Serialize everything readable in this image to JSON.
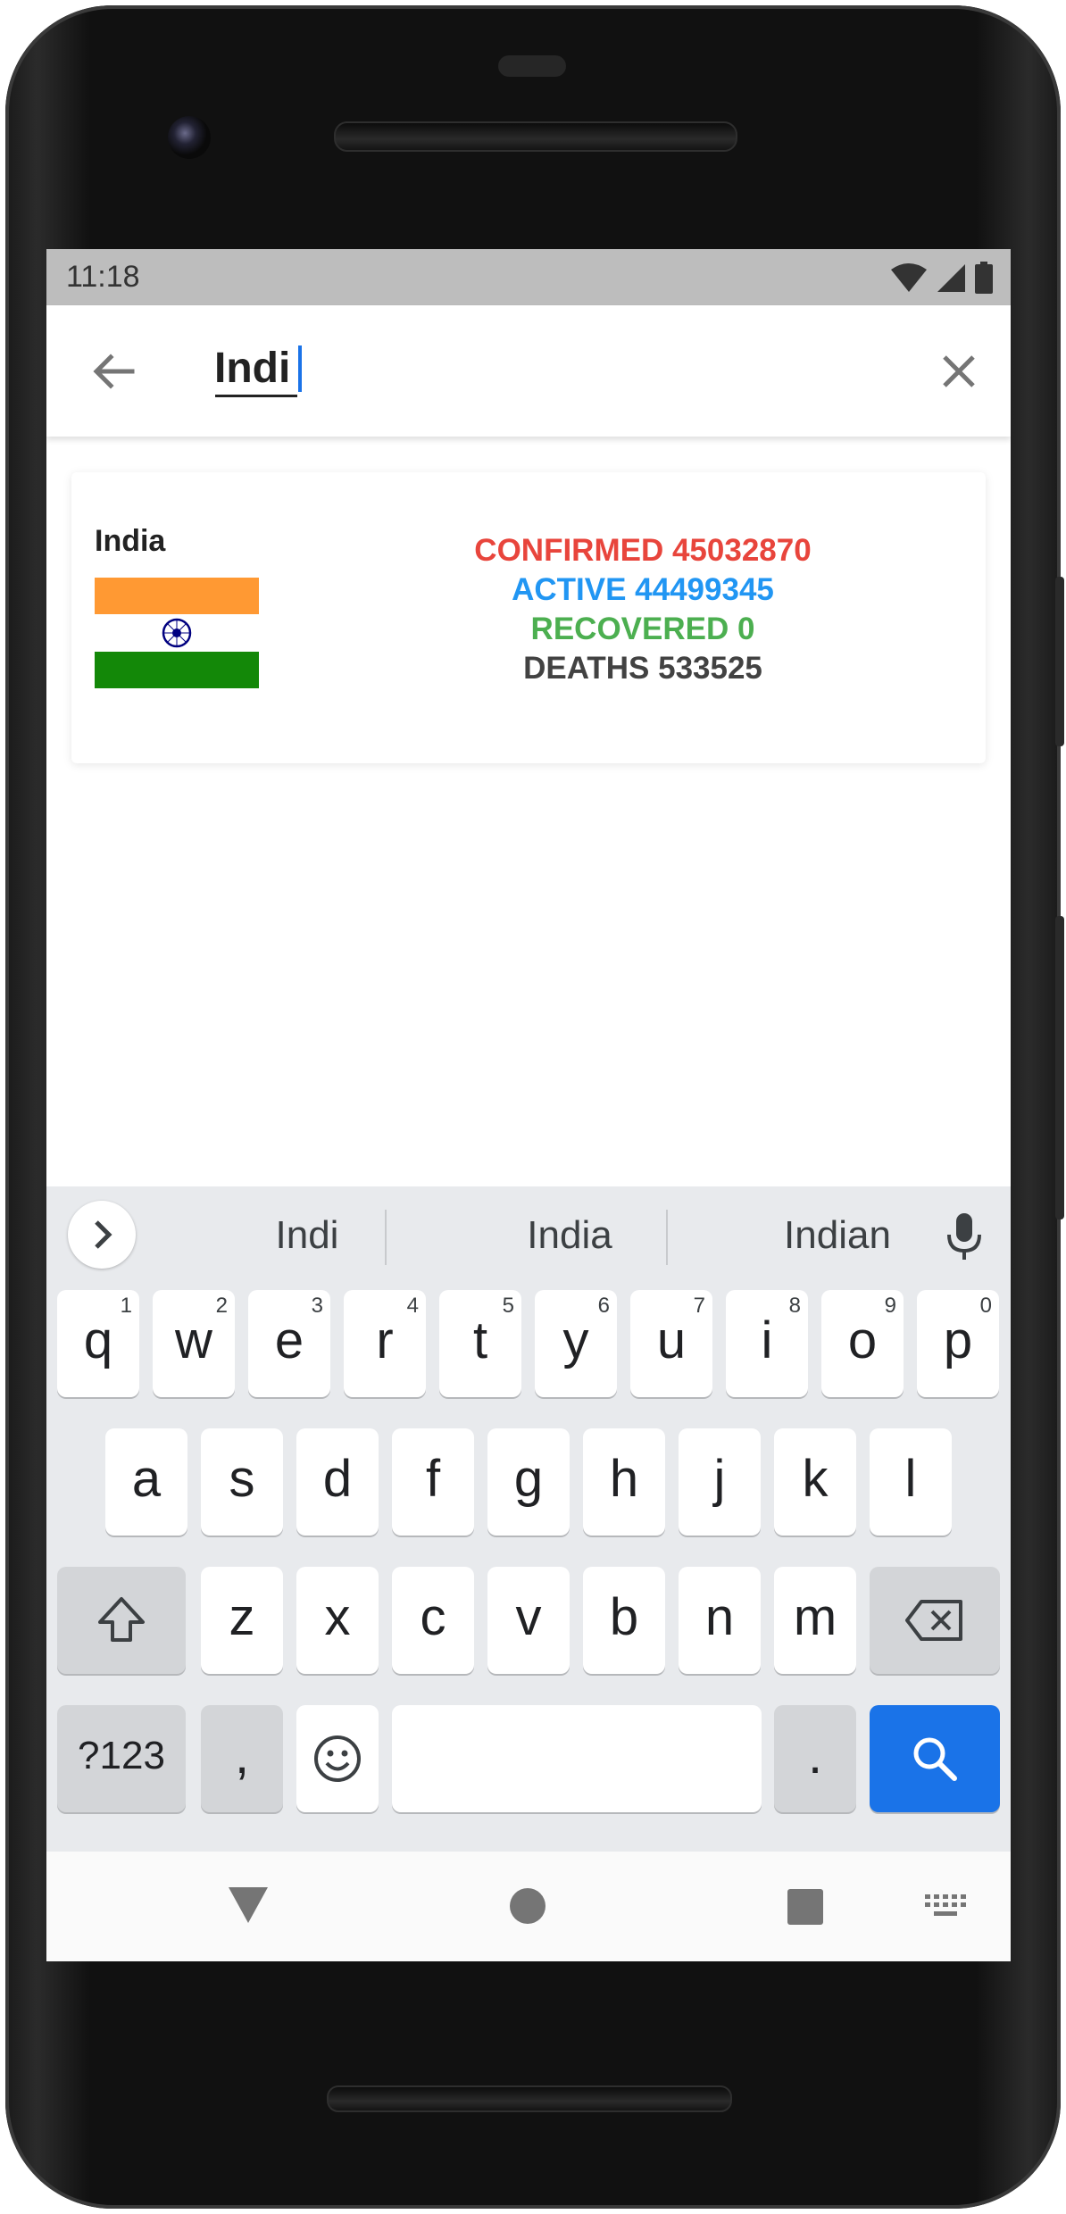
{
  "status_bar": {
    "time": "11:18"
  },
  "search": {
    "value": "Indi"
  },
  "result": {
    "country": "India",
    "confirmed": "CONFIRMED 45032870",
    "active": "ACTIVE 44499345",
    "recovered": "RECOVERED 0",
    "deaths": "DEATHS 533525"
  },
  "keyboard": {
    "suggestions": [
      "Indi",
      "India",
      "Indian"
    ],
    "row1": [
      {
        "key": "q",
        "hint": "1"
      },
      {
        "key": "w",
        "hint": "2"
      },
      {
        "key": "e",
        "hint": "3"
      },
      {
        "key": "r",
        "hint": "4"
      },
      {
        "key": "t",
        "hint": "5"
      },
      {
        "key": "y",
        "hint": "6"
      },
      {
        "key": "u",
        "hint": "7"
      },
      {
        "key": "i",
        "hint": "8"
      },
      {
        "key": "o",
        "hint": "9"
      },
      {
        "key": "p",
        "hint": "0"
      }
    ],
    "row2": [
      "a",
      "s",
      "d",
      "f",
      "g",
      "h",
      "j",
      "k",
      "l"
    ],
    "row3": [
      "z",
      "x",
      "c",
      "v",
      "b",
      "n",
      "m"
    ],
    "symbols_label": "?123",
    "comma": ",",
    "period": "."
  },
  "colors": {
    "confirmed": "#e8453c",
    "active": "#2196f3",
    "recovered": "#4caf50",
    "deaths": "#424242",
    "accent": "#1a73e8"
  }
}
